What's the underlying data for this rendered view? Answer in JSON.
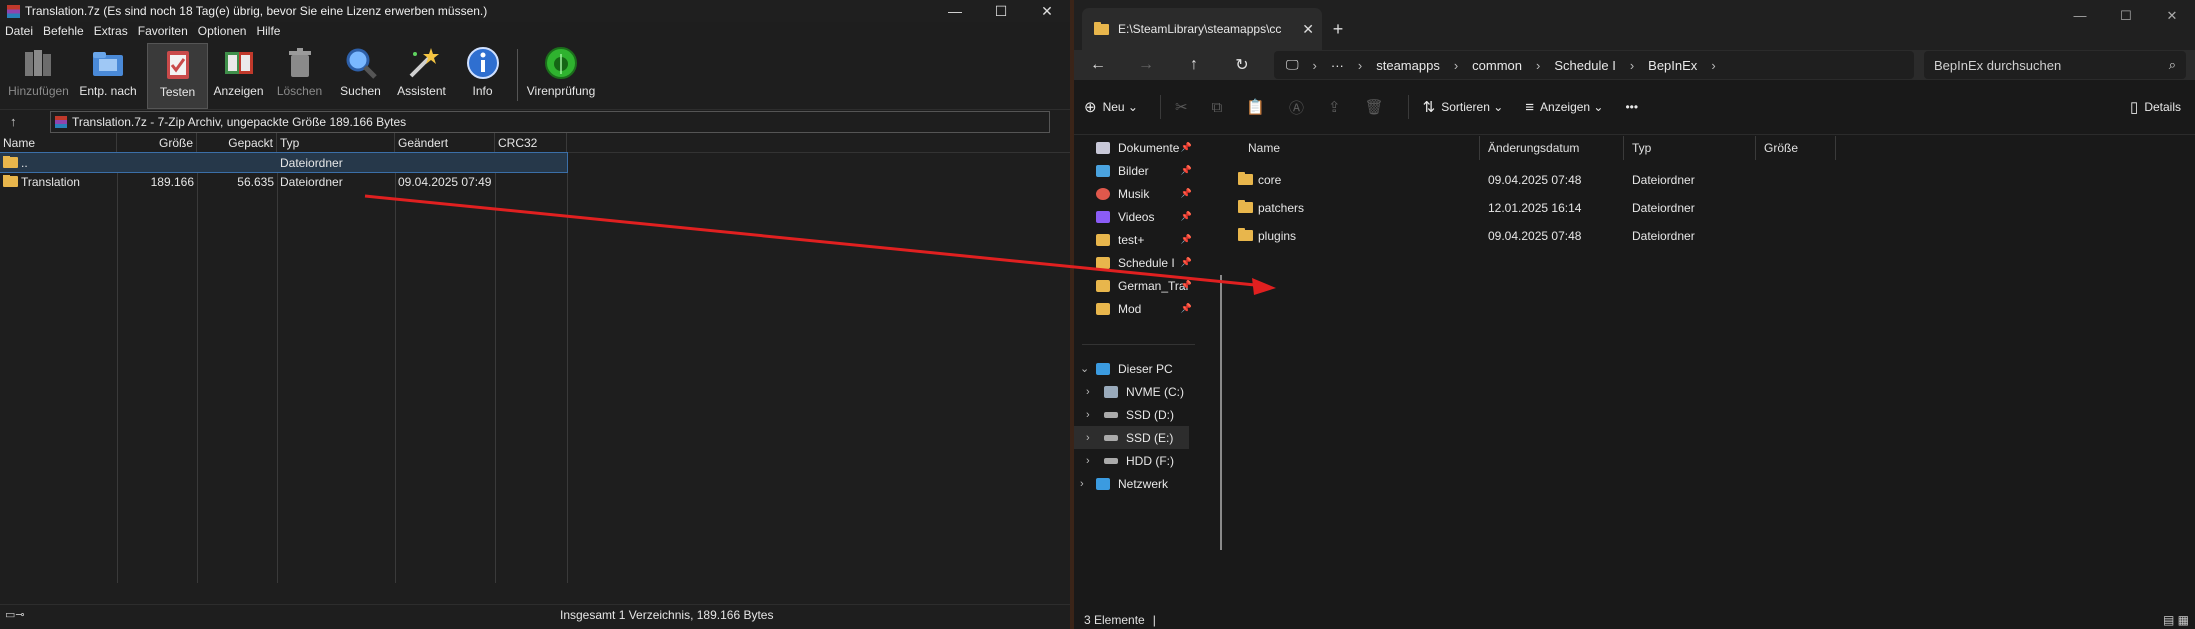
{
  "rar": {
    "title": "Translation.7z (Es sind noch 18 Tag(e) übrig, bevor Sie eine Lizenz erwerben müssen.)",
    "menu": [
      "Datei",
      "Befehle",
      "Extras",
      "Favoriten",
      "Optionen",
      "Hilfe"
    ],
    "toolbar": [
      "Hinzufügen",
      "Entp. nach",
      "Testen",
      "Anzeigen",
      "Löschen",
      "Suchen",
      "Assistent",
      "Info",
      "Virenprüfung"
    ],
    "address": "Translation.7z - 7-Zip Archiv, ungepackte Größe 189.166 Bytes",
    "columns": [
      "Name",
      "Größe",
      "Gepackt",
      "Typ",
      "Geändert",
      "CRC32"
    ],
    "rows": [
      {
        "name": "..",
        "size": "",
        "packed": "",
        "type": "Dateiordner",
        "modified": "",
        "crc": ""
      },
      {
        "name": "Translation",
        "size": "189.166",
        "packed": "56.635",
        "type": "Dateiordner",
        "modified": "09.04.2025 07:49",
        "crc": ""
      }
    ],
    "status": "Insgesamt 1 Verzeichnis, 189.166 Bytes"
  },
  "explorer": {
    "tab_title": "E:\\SteamLibrary\\steamapps\\cc",
    "breadcrumb": [
      "···",
      "steamapps",
      "common",
      "Schedule I",
      "BepInEx"
    ],
    "search_placeholder": "BepInEx durchsuchen",
    "commands": {
      "new": "Neu",
      "sort": "Sortieren",
      "view": "Anzeigen",
      "details": "Details"
    },
    "nav": [
      {
        "label": "Dokumente",
        "color": "#c8c8d8"
      },
      {
        "label": "Bilder",
        "color": "#4aa3df"
      },
      {
        "label": "Musik",
        "color": "#e0584c"
      },
      {
        "label": "Videos",
        "color": "#8b5cf6"
      },
      {
        "label": "test+",
        "color": "#e8b64c"
      },
      {
        "label": "Schedule I",
        "color": "#e8b64c"
      },
      {
        "label": "German_Trar",
        "color": "#e8b64c"
      },
      {
        "label": "Mod",
        "color": "#e8b64c"
      }
    ],
    "this_pc": "Dieser PC",
    "drives": [
      "NVME (C:)",
      "SSD (D:)",
      "SSD (E:)",
      "HDD (F:)"
    ],
    "network": "Netzwerk",
    "columns": [
      "Name",
      "Änderungsdatum",
      "Typ",
      "Größe"
    ],
    "files": [
      {
        "name": "core",
        "date": "09.04.2025 07:48",
        "type": "Dateiordner"
      },
      {
        "name": "patchers",
        "date": "12.01.2025 16:14",
        "type": "Dateiordner"
      },
      {
        "name": "plugins",
        "date": "09.04.2025 07:48",
        "type": "Dateiordner"
      }
    ],
    "status": "3 Elemente"
  },
  "colors": {
    "arrow": "#e02020",
    "accent": "#3b6fa8",
    "folder": "#e8b64c"
  }
}
